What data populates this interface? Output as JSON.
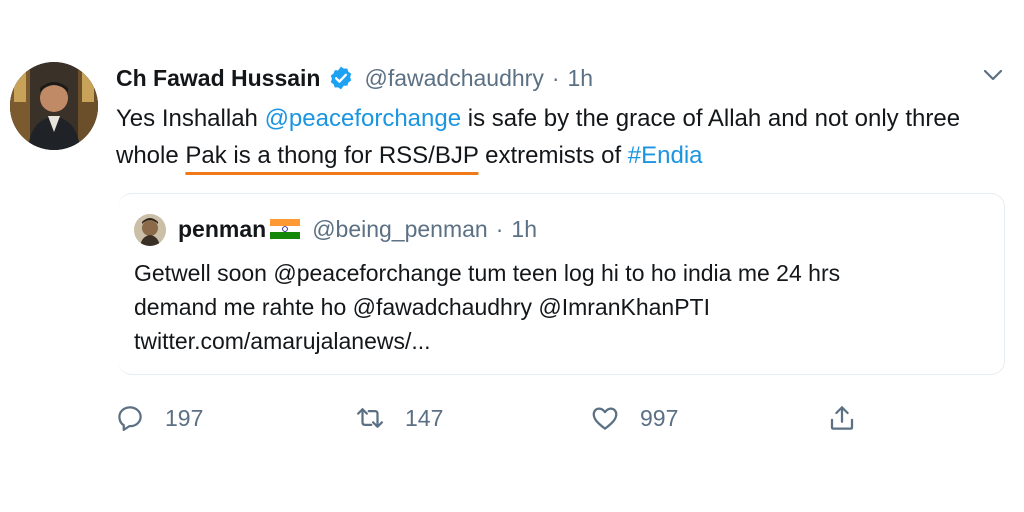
{
  "tweet": {
    "author_name": "Ch Fawad Hussain",
    "author_handle": "@fawadchaudhry",
    "separator": "·",
    "time": "1h",
    "text": {
      "part1": "Yes Inshallah ",
      "mention": "@peaceforchange",
      "part2": " is safe by the grace of Allah and not only three whole ",
      "highlighted": "Pak is a thong for RSS/BJP",
      "part3": " extremists of ",
      "hashtag": "#Endia"
    }
  },
  "quote": {
    "author_name": "penman",
    "author_handle": "@being_penman",
    "separator": "·",
    "time": "1h",
    "line1": "Getwell soon @peaceforchange tum teen log hi to ho india me 24 hrs",
    "line2": "demand me rahte ho @fawadchaudhry @ImranKhanPTI",
    "line3": "twitter.com/amarujalanews/..."
  },
  "actions": {
    "replies": "197",
    "retweets": "147",
    "likes": "997"
  },
  "icons": {
    "verified": "verified-badge-icon",
    "caret": "chevron-down-icon",
    "reply": "reply-icon",
    "retweet": "retweet-icon",
    "like": "heart-icon",
    "share": "share-icon",
    "flag": "india-flag-emoji"
  },
  "colors": {
    "link": "#1b95e0",
    "secondary_text": "#5b7083",
    "highlight_underline": "#f07a1a",
    "verified": "#1da1f2"
  }
}
